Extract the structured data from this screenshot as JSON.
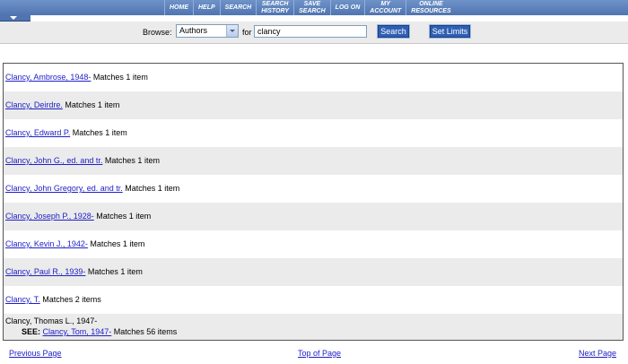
{
  "nav": {
    "items": [
      "HOME",
      "HELP",
      "SEARCH",
      "SEARCH\nHISTORY",
      "SAVE\nSEARCH",
      "LOG ON",
      "MY\nACCOUNT",
      "ONLINE\nRESOURCES"
    ]
  },
  "search": {
    "browse_label": "Browse:",
    "field_value": "Authors",
    "for_label": "for",
    "query": "clancy",
    "search_button": "Search",
    "limits_button": "Set Limits"
  },
  "results": [
    {
      "name": "Clancy, Ambrose, 1948-",
      "matches": "Matches 1 item"
    },
    {
      "name": "Clancy, Deirdre.",
      "matches": "Matches 1 item"
    },
    {
      "name": "Clancy, Edward P.",
      "matches": "Matches 1 item"
    },
    {
      "name": "Clancy, John G., ed. and tr.",
      "matches": "Matches 1 item"
    },
    {
      "name": "Clancy, John Gregory, ed. and tr.",
      "matches": "Matches 1 item"
    },
    {
      "name": "Clancy, Joseph P., 1928-",
      "matches": "Matches 1 item"
    },
    {
      "name": "Clancy, Kevin J., 1942-",
      "matches": "Matches 1 item"
    },
    {
      "name": "Clancy, Paul R., 1939-",
      "matches": "Matches 1 item"
    },
    {
      "name": "Clancy, T.",
      "matches": "Matches 2 items"
    }
  ],
  "see_entry": {
    "heading": "Clancy, Thomas L., 1947-",
    "see_label": "SEE:",
    "link": "Clancy, Tom, 1947-",
    "matches": "Matches 56 items"
  },
  "footer": {
    "previous": "Previous Page",
    "top": "Top of Page",
    "next": "Next Page"
  },
  "colors": {
    "nav_bar": "#5b80bd",
    "link": "#2020c8",
    "button": "#2f5fb3",
    "row_alt": "#ebebeb"
  }
}
